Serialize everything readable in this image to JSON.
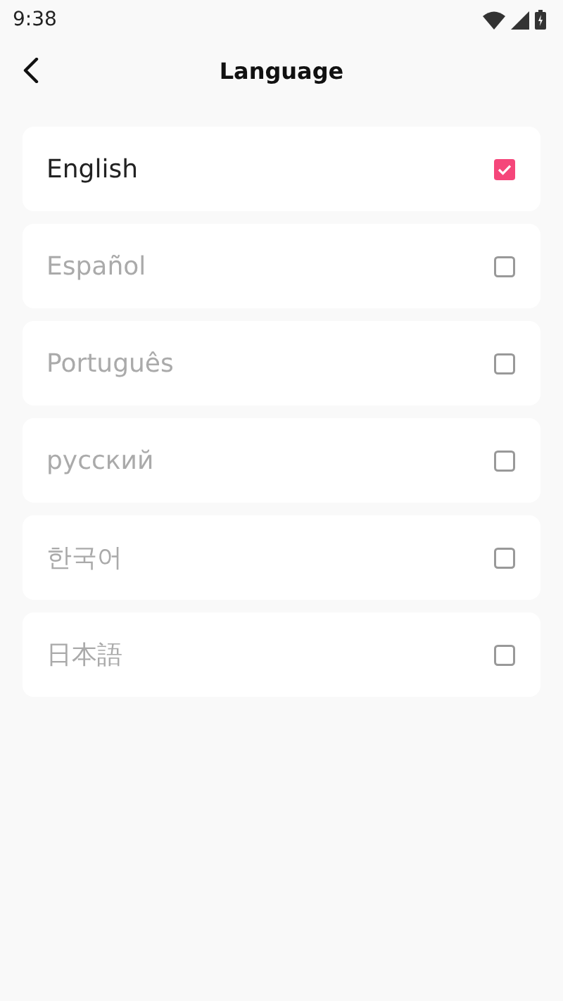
{
  "status_bar": {
    "time": "9:38"
  },
  "header": {
    "title": "Language"
  },
  "languages": [
    {
      "label": "English",
      "selected": true
    },
    {
      "label": "Español",
      "selected": false
    },
    {
      "label": "Português",
      "selected": false
    },
    {
      "label": "русский",
      "selected": false
    },
    {
      "label": "한국어",
      "selected": false
    },
    {
      "label": "日本語",
      "selected": false
    }
  ]
}
